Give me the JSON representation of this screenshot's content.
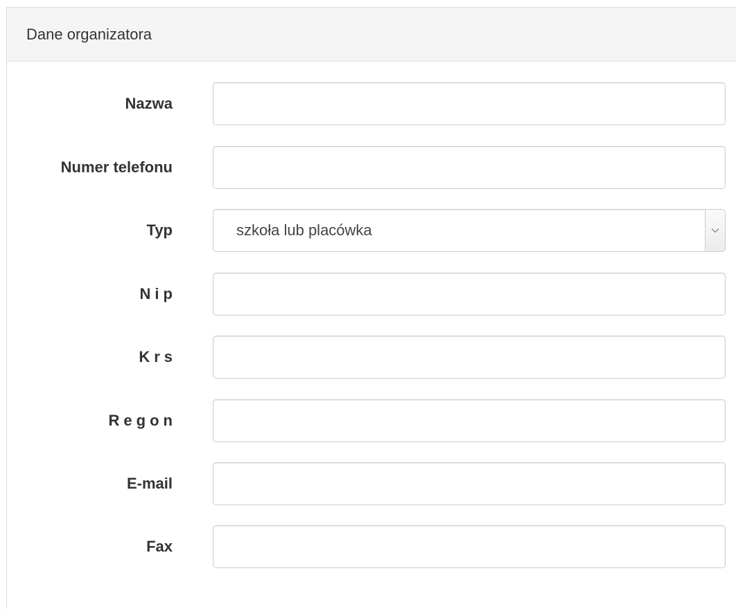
{
  "panel": {
    "heading": "Dane organizatora"
  },
  "fields": [
    {
      "label": "Nazwa",
      "value": ""
    },
    {
      "label": "Numer telefonu",
      "value": ""
    },
    {
      "label": "Typ",
      "selected": "szkoła lub placówka"
    },
    {
      "label": "Nip",
      "value": ""
    },
    {
      "label": "Krs",
      "value": ""
    },
    {
      "label": "Regon",
      "value": ""
    },
    {
      "label": "E-mail",
      "value": ""
    },
    {
      "label": "Fax",
      "value": ""
    }
  ],
  "icons": {
    "select_arrow": "chevron-down-icon"
  },
  "colors": {
    "panel_heading_bg": "#f5f5f5",
    "border": "#cccccc",
    "text": "#333333"
  }
}
